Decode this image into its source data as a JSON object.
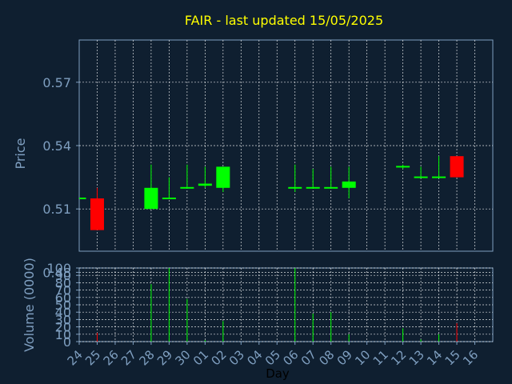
{
  "chart_data": {
    "type": "candlestick",
    "title": "FAIR - last updated 15/05/2025",
    "xlabel": "Day",
    "ylabel_price": "Price",
    "ylabel_volume": "Volume (0000)",
    "ylim_price": [
      0.49,
      0.59
    ],
    "ylim_volume": [
      0,
      100
    ],
    "price_ticks": [
      "0.57",
      "0.54",
      "0.51",
      "0.48"
    ],
    "volume_ticks": [
      "100",
      "90",
      "80",
      "70",
      "60",
      "50",
      "40",
      "30",
      "20",
      "10",
      "0"
    ],
    "x_ticks": [
      "24",
      "25",
      "26",
      "27",
      "28",
      "29",
      "30",
      "01",
      "02",
      "03",
      "04",
      "05",
      "06",
      "07",
      "08",
      "09",
      "10",
      "11",
      "12",
      "13",
      "14",
      "15",
      "16"
    ],
    "candles": [
      {
        "day": "24",
        "open": 0.515,
        "high": 0.515,
        "low": 0.515,
        "close": 0.515,
        "volume": 0
      },
      {
        "day": "25",
        "open": 0.515,
        "high": 0.52,
        "low": 0.5,
        "close": 0.5,
        "volume": 12
      },
      {
        "day": "28",
        "open": 0.51,
        "high": 0.531,
        "low": 0.51,
        "close": 0.52,
        "volume": 78
      },
      {
        "day": "29",
        "open": 0.515,
        "high": 0.525,
        "low": 0.515,
        "close": 0.515,
        "volume": 100
      },
      {
        "day": "30",
        "open": 0.52,
        "high": 0.531,
        "low": 0.52,
        "close": 0.52,
        "volume": 58
      },
      {
        "day": "01",
        "open": 0.521,
        "high": 0.53,
        "low": 0.52,
        "close": 0.522,
        "volume": 2
      },
      {
        "day": "02",
        "open": 0.52,
        "high": 0.53,
        "low": 0.518,
        "close": 0.53,
        "volume": 28
      },
      {
        "day": "06",
        "open": 0.52,
        "high": 0.531,
        "low": 0.518,
        "close": 0.52,
        "volume": 100
      },
      {
        "day": "07",
        "open": 0.52,
        "high": 0.529,
        "low": 0.52,
        "close": 0.52,
        "volume": 38
      },
      {
        "day": "08",
        "open": 0.52,
        "high": 0.53,
        "low": 0.52,
        "close": 0.52,
        "volume": 40
      },
      {
        "day": "09",
        "open": 0.52,
        "high": 0.53,
        "low": 0.515,
        "close": 0.523,
        "volume": 10
      },
      {
        "day": "12",
        "open": 0.53,
        "high": 0.531,
        "low": 0.529,
        "close": 0.53,
        "volume": 18
      },
      {
        "day": "13",
        "open": 0.525,
        "high": 0.53,
        "low": 0.525,
        "close": 0.525,
        "volume": 3
      },
      {
        "day": "14",
        "open": 0.525,
        "high": 0.535,
        "low": 0.525,
        "close": 0.525,
        "volume": 10
      },
      {
        "day": "15",
        "open": 0.535,
        "high": 0.535,
        "low": 0.525,
        "close": 0.525,
        "volume": 25
      }
    ],
    "colors": {
      "background": "#0f1f30",
      "title": "#ffff00",
      "axis_text": "#7f9fc0",
      "grid": "#ffffff",
      "axis_line": "#7f9fc0",
      "up": "#00ff00",
      "down": "#ff0000",
      "xlabel": "#000000"
    },
    "grid": true
  }
}
